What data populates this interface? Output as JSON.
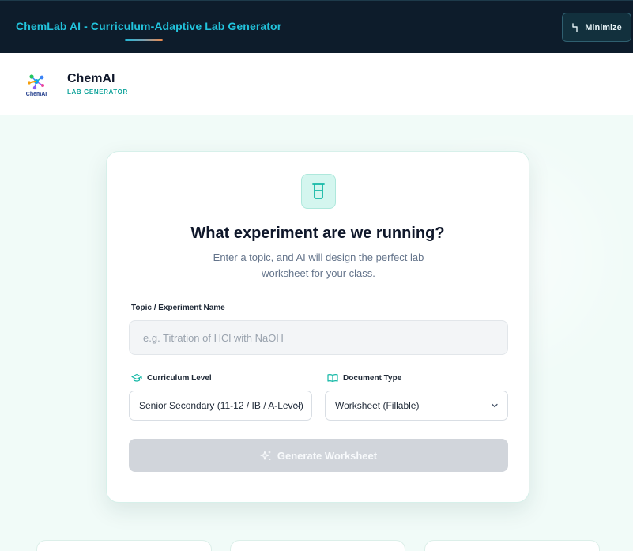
{
  "window": {
    "title": "ChemLab AI - Curriculum-Adaptive Lab Generator",
    "minimize_label": "Minimize"
  },
  "header": {
    "logo_text": "ChemAI",
    "brand_name": "ChemAI",
    "brand_sub": "LAB GENERATOR"
  },
  "card": {
    "title": "What experiment are we running?",
    "subtitle": "Enter a topic, and AI will design the perfect lab worksheet for your class.",
    "topic": {
      "label": "Topic / Experiment Name",
      "value": "",
      "placeholder": "e.g. Titration of HCl with NaOH"
    },
    "curriculum": {
      "label": "Curriculum Level",
      "selected": "Senior Secondary (11-12 / IB / A-Level)"
    },
    "document": {
      "label": "Document Type",
      "selected": "Worksheet (Fillable)"
    },
    "generate_label": "Generate Worksheet"
  },
  "colors": {
    "titlebar_bg": "#0d1c2b",
    "title_accent": "#22c3dc",
    "brand_accent": "#0fa39a",
    "button_disabled": "#d1d5db"
  },
  "icons": {
    "minimize": "minimize-icon",
    "logo": "molecule-logo-icon",
    "card": "beaker-icon",
    "curriculum": "graduation-cap-icon",
    "document": "open-book-icon",
    "generate": "sparkles-icon",
    "dropdown": "chevron-down-icon"
  }
}
